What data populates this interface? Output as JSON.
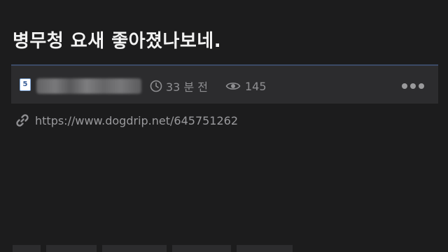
{
  "post": {
    "title": "병무청 요새 좋아졌나보네.",
    "author_level": "5",
    "time_ago": "33 분 전",
    "views": "145",
    "link_url": "https://www.dogdrip.net/645751262"
  },
  "icons": {
    "level_badge": "level-badge-icon",
    "time": "clock-icon",
    "views": "eye-icon",
    "more": "more-options-icon",
    "link": "link-icon"
  },
  "colors": {
    "background": "#1c1c1d",
    "meta_bar": "#2c2c2e",
    "meta_bar_accent": "#3b4a66",
    "muted_text": "#8f8f92"
  }
}
